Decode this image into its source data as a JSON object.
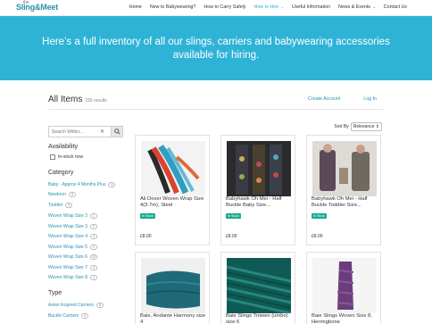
{
  "nav": {
    "logo_main": "Sling&Meet",
    "logo_small": "the",
    "items": [
      {
        "label": "Home"
      },
      {
        "label": "New to Babywearing?"
      },
      {
        "label": "How to Carry Safely"
      },
      {
        "label": "How to Hire",
        "caret": "⌄"
      },
      {
        "label": "Useful Information"
      },
      {
        "label": "News & Events",
        "caret": "⌄"
      },
      {
        "label": "Contact Us"
      }
    ]
  },
  "hero": {
    "text": "Here’s a full inventory of all our slings, carriers and babywearing accessories available for hiring."
  },
  "header": {
    "title": "All Items",
    "count": "155 results",
    "create_account": "Create Account",
    "login": "Log In"
  },
  "search": {
    "placeholder": "Search Within...",
    "clear": "✕"
  },
  "availability": {
    "title": "Availability",
    "option": "In-stock now"
  },
  "category": {
    "title": "Category",
    "items": [
      {
        "label": "Baby - Approx 4 Months Plus",
        "count": "5"
      },
      {
        "label": "Newborn",
        "count": "5"
      },
      {
        "label": "Toddler",
        "count": "3"
      },
      {
        "label": "Woven Wrap Size 2",
        "count": "1"
      },
      {
        "label": "Woven Wrap Size 3",
        "count": "2"
      },
      {
        "label": "Woven Wrap Size 4",
        "count": "4"
      },
      {
        "label": "Woven Wrap Size 5",
        "count": "1"
      },
      {
        "label": "Woven Wrap Size 6",
        "count": "12"
      },
      {
        "label": "Woven Wrap Size 7",
        "count": "3"
      },
      {
        "label": "Woven Wrap Size 8",
        "count": "1"
      }
    ]
  },
  "type": {
    "title": "Type",
    "items": [
      {
        "label": "Asian Inspired Carriers",
        "count": "8"
      },
      {
        "label": "Buckle Carriers",
        "count": "5"
      }
    ]
  },
  "sort": {
    "label": "Sort By",
    "selected": "Relevance"
  },
  "products": [
    {
      "title": "Ali Dover Woven Wrap Size 4(3.7m), Steel",
      "stock": "In Stock",
      "price": "£8.00"
    },
    {
      "title": "Babyhawk Oh Mei - Half Buckle Baby Size...",
      "stock": "In Stock",
      "price": "£8.00"
    },
    {
      "title": "Babyhawk Oh Mei - Half Buckle Toddler Size...",
      "stock": "In Stock",
      "price": "£8.00"
    },
    {
      "title": "Baie, Andante Harmony size 4",
      "stock": "",
      "price": ""
    },
    {
      "title": "Baie Slings Trowen (umbo) size 6",
      "stock": "",
      "price": ""
    },
    {
      "title": "Baie Slings Woven Size 8, Herringbone",
      "stock": "",
      "price": ""
    }
  ],
  "colors": {
    "accent": "#2eb3d7",
    "link": "#2a8fb0",
    "stock_badge": "#1aaa8e"
  }
}
